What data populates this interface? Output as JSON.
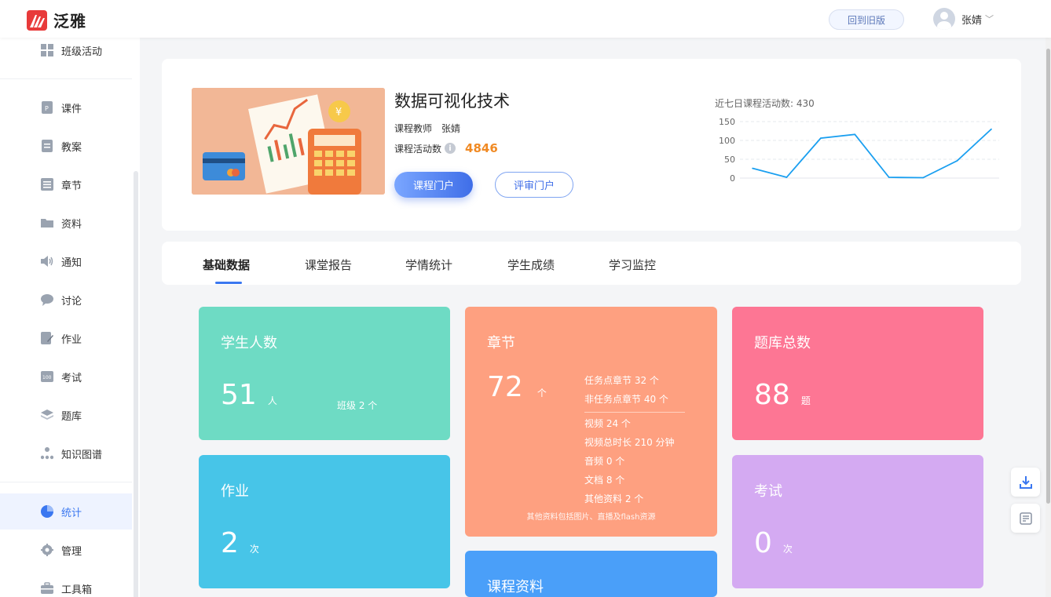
{
  "header": {
    "brand": "泛雅",
    "old_version_label": "回到旧版",
    "user_name": "张婧"
  },
  "sidebar": {
    "items": [
      {
        "label": "班级活动"
      },
      {
        "label": "课件"
      },
      {
        "label": "教案"
      },
      {
        "label": "章节"
      },
      {
        "label": "资料"
      },
      {
        "label": "通知"
      },
      {
        "label": "讨论"
      },
      {
        "label": "作业"
      },
      {
        "label": "考试"
      },
      {
        "label": "题库"
      },
      {
        "label": "知识图谱"
      },
      {
        "label": "统计"
      },
      {
        "label": "管理"
      },
      {
        "label": "工具箱"
      }
    ],
    "active": "统计"
  },
  "course": {
    "title": "数据可视化技术",
    "teacher_label": "课程教师",
    "teacher_name": "张婧",
    "activity_label": "课程活动数",
    "activity_count": "4846",
    "portal_button": "课程门户",
    "review_button": "评审门户"
  },
  "mini_chart": {
    "title": "近七日课程活动数: 430",
    "y_ticks": [
      "150",
      "100",
      "50",
      "0"
    ]
  },
  "chart_data": {
    "type": "line",
    "title": "近七日课程活动数: 430",
    "ylim": [
      0,
      150
    ],
    "y_ticks": [
      0,
      50,
      100,
      150
    ],
    "series": [
      {
        "values": [
          26,
          2,
          106,
          116,
          2,
          1,
          46,
          130
        ]
      }
    ],
    "color": "#1a9ff0"
  },
  "tabs": [
    {
      "label": "基础数据",
      "active": true
    },
    {
      "label": "课堂报告",
      "active": false
    },
    {
      "label": "学情统计",
      "active": false
    },
    {
      "label": "学生成绩",
      "active": false
    },
    {
      "label": "学习监控",
      "active": false
    }
  ],
  "cards": {
    "students": {
      "title": "学生人数",
      "value": "51",
      "unit": "人",
      "extra": "班级 2 个"
    },
    "homework": {
      "title": "作业",
      "value": "2",
      "unit": "次"
    },
    "chapters": {
      "title": "章节",
      "value": "72",
      "unit": "个",
      "details_top": [
        "任务点章节 32 个",
        "非任务点章节 40 个"
      ],
      "details_bottom": [
        "视频 24 个",
        "视频总时长 210 分钟",
        "音频 0 个",
        "文档 8 个",
        "其他资料 2 个"
      ],
      "note": "其他资料包括图片、直播及flash资源"
    },
    "materials": {
      "title": "课程资料"
    },
    "question_bank": {
      "title": "题库总数",
      "value": "88",
      "unit": "题"
    },
    "exams": {
      "title": "考试",
      "value": "0",
      "unit": "次"
    }
  },
  "colors": {
    "accent": "#3a77f0",
    "green": "#6edbc4",
    "cyan": "#47c5e8",
    "orange": "#fea080",
    "blue": "#4a9ff9",
    "pink": "#fd7694",
    "purple": "#d4aaf2",
    "activity_count": "#f08a24"
  }
}
